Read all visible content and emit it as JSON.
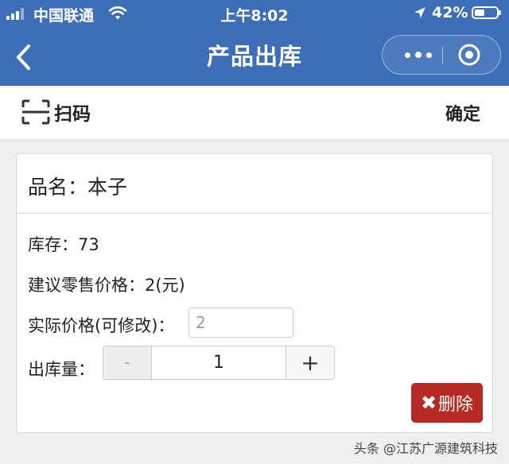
{
  "status_bar": {
    "carrier": "中国联通",
    "time": "上午8:02",
    "battery": "42%"
  },
  "nav": {
    "title": "产品出库"
  },
  "toolbar": {
    "scan_label": "扫码",
    "confirm_label": "确定"
  },
  "product": {
    "name_label": "品名：本子",
    "stock_label": "库存：73",
    "suggested_price_label": "建议零售价格：2(元)",
    "actual_price_label": "实际价格(可修改)：",
    "actual_price_value": "2",
    "quantity_label": "出库量：",
    "minus_label": "-",
    "quantity_value": "1",
    "plus_label": "+",
    "delete_icon": "✖",
    "delete_label": "删除"
  },
  "watermark": "头条 @江苏广源建筑科技",
  "colors": {
    "header_blue": "#3d6fb8",
    "delete_red": "#b72a24"
  },
  "icons": [
    "signal-icon",
    "wifi-icon",
    "location-arrow-icon",
    "battery-icon",
    "back-chevron-icon",
    "more-dots-icon",
    "target-icon",
    "scan-icon"
  ]
}
